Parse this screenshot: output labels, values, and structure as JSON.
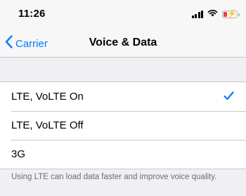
{
  "status_bar": {
    "time": "11:26",
    "icons": [
      "cellular-signal-icon",
      "wifi-icon",
      "battery-charging-icon"
    ],
    "battery_color": "#ff3b30"
  },
  "nav": {
    "back_label": "Carrier",
    "title": "Voice & Data",
    "accent_color": "#007aff"
  },
  "options": [
    {
      "label": "LTE, VoLTE On",
      "selected": true
    },
    {
      "label": "LTE, VoLTE Off",
      "selected": false
    },
    {
      "label": "3G",
      "selected": false
    }
  ],
  "footer_note": "Using LTE can load data faster and improve voice quality."
}
